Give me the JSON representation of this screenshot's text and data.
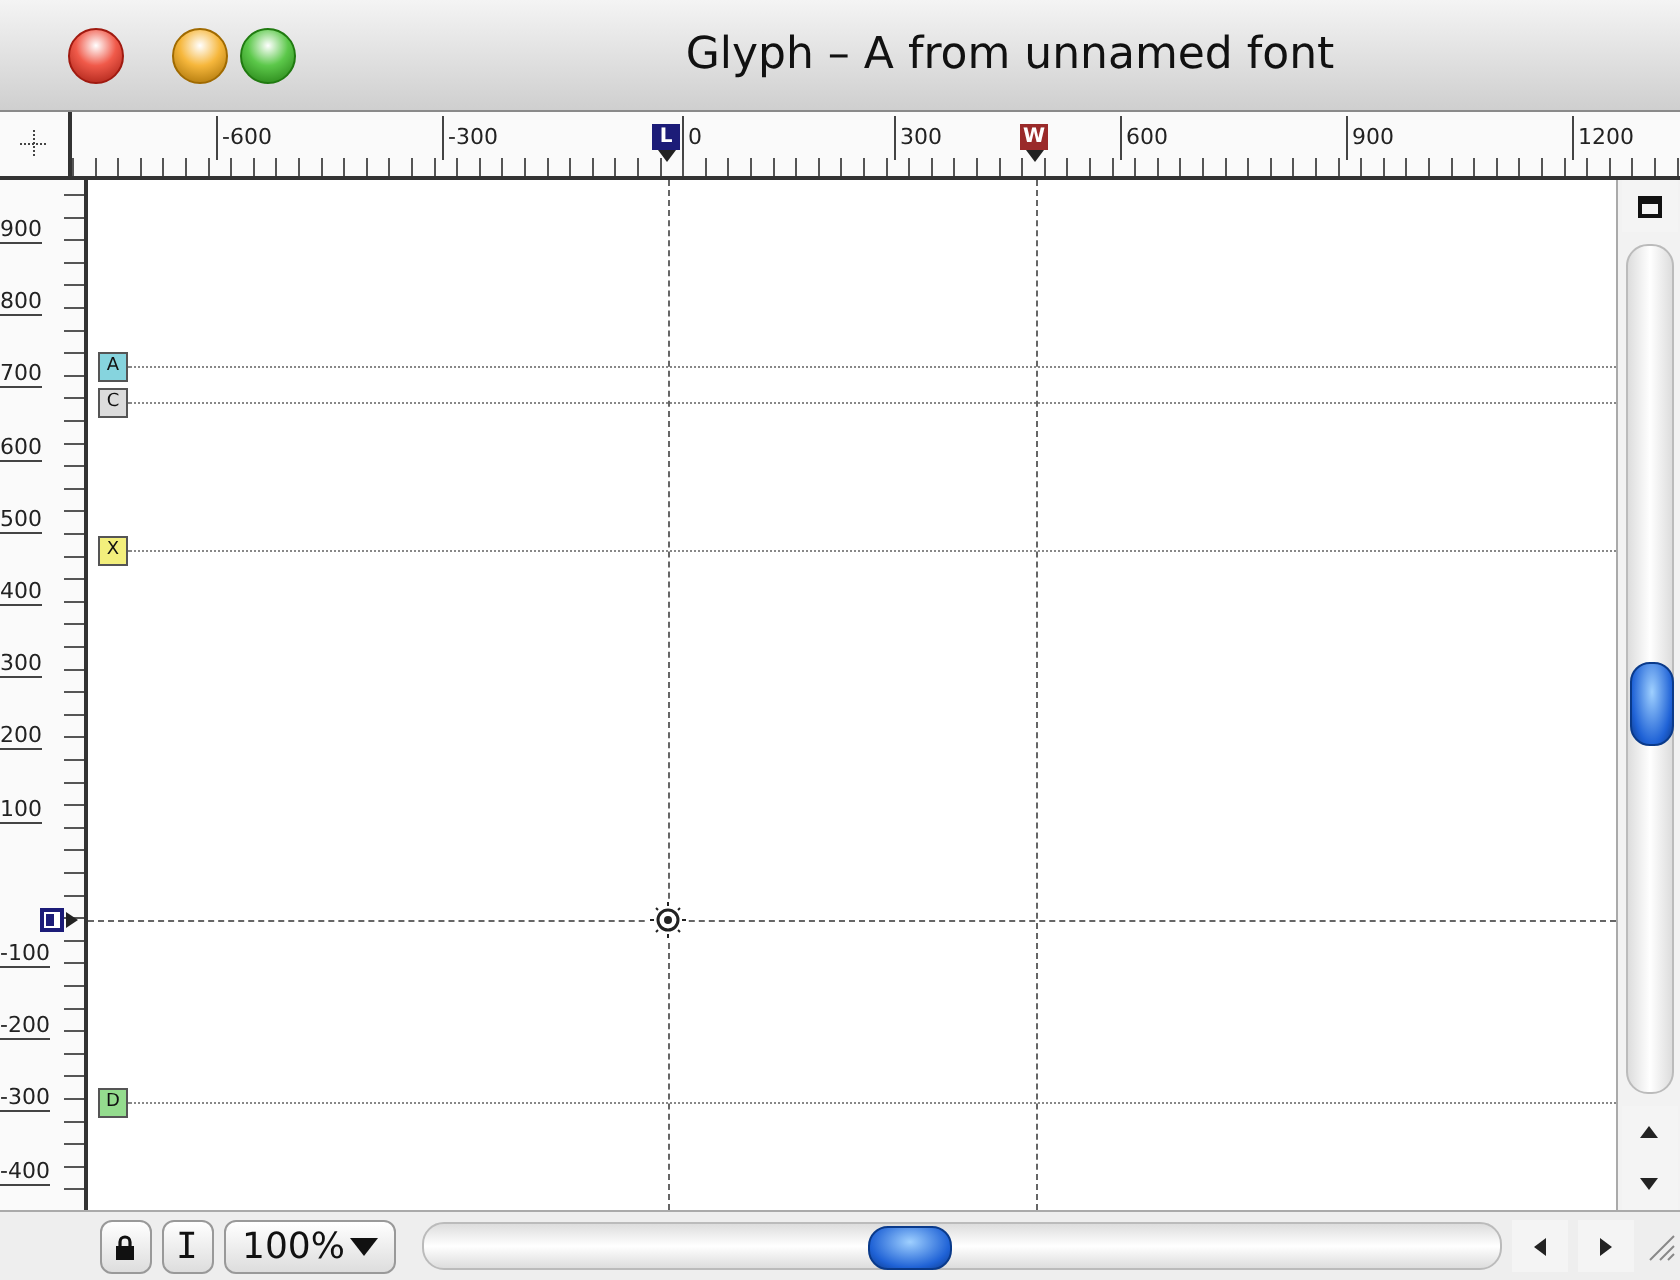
{
  "window": {
    "title": "Glyph – A from unnamed font"
  },
  "h_ruler": {
    "labels": [
      "-600",
      "-300",
      "0",
      "300",
      "600",
      "900",
      "1200"
    ],
    "markers": [
      {
        "label": "L",
        "color": "#1c1c78"
      },
      {
        "label": "W",
        "color": "#9a2a2a"
      }
    ]
  },
  "v_ruler": {
    "labels": [
      "900",
      "800",
      "700",
      "600",
      "500",
      "400",
      "300",
      "200",
      "100",
      "-100",
      "-200",
      "-300",
      "-400"
    ]
  },
  "guides": [
    {
      "label": "A",
      "color": "#86d4de"
    },
    {
      "label": "C",
      "color": "#dcdcdc"
    },
    {
      "label": "X",
      "color": "#f3ef7c"
    },
    {
      "label": "D",
      "color": "#94dc8e"
    }
  ],
  "bottom_bar": {
    "text_tool": "I",
    "zoom": "100%"
  }
}
